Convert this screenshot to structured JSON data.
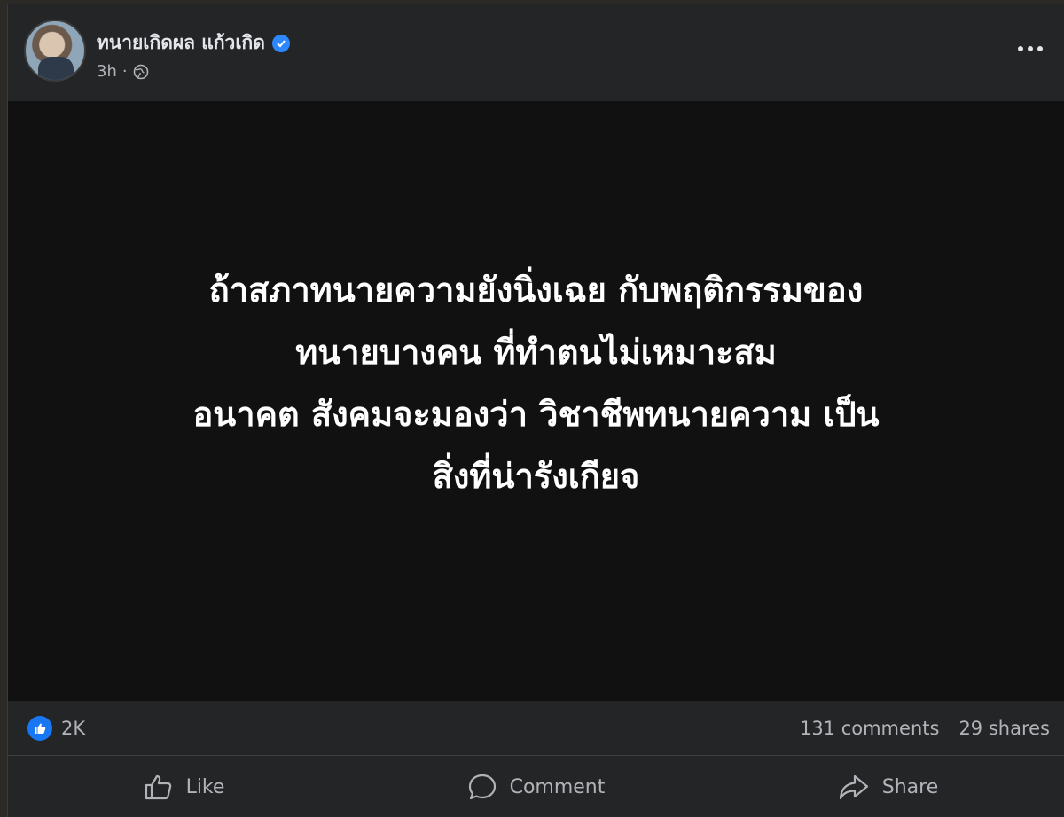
{
  "post": {
    "author": "ทนายเกิดผล แก้วเกิด",
    "time": "3h",
    "separator": "·",
    "text_lines": [
      "ถ้าสภาทนายความยังนิ่งเฉย กับพฤติกรรมของ",
      "ทนายบางคน ที่ทำตนไม่เหมาะสม",
      "อนาคต สังคมจะมองว่า วิชาชีพทนายความ เป็น",
      "สิ่งที่น่ารังเกียจ"
    ],
    "background_color": "#111111"
  },
  "stats": {
    "reactions_count": "2K",
    "comments": "131 comments",
    "shares": "29 shares"
  },
  "actions": {
    "like_label": "Like",
    "comment_label": "Comment",
    "share_label": "Share"
  },
  "icons": {
    "verified": "verified-badge-icon",
    "audience": "globe-icon",
    "more": "more-options-icon",
    "like": "thumbs-up-icon",
    "comment": "speech-bubble-icon",
    "share": "share-arrow-icon"
  },
  "colors": {
    "accent": "#1877f2",
    "verified": "#2d88ff",
    "card": "#242526",
    "text_secondary": "#b0b3b8"
  }
}
